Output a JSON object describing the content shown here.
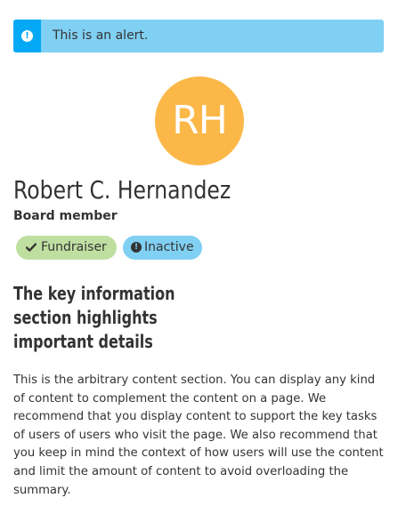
{
  "alert": {
    "icon": "exclamation-circle-icon",
    "text": "This is an alert.",
    "color": "#80d0f3",
    "accent_color": "#03a9f4"
  },
  "profile": {
    "initials": "RH",
    "avatar_color": "#fbb848",
    "name": "Robert C. Hernandez",
    "role": "Board member"
  },
  "badges": [
    {
      "icon": "check-icon",
      "label": "Fundraiser",
      "color": "#bfdfa1"
    },
    {
      "icon": "exclamation-circle-icon",
      "label": "Inactive",
      "color": "#80d0f3"
    }
  ],
  "key_information": {
    "lines": [
      "The key information",
      "section highlights",
      "important details"
    ]
  },
  "content": {
    "text": "This is the arbitrary content section. You can display any kind of content to complement the content on a page. We recommend that you display content to support the key tasks of users of users who visit the page. We also recommend that you keep in mind the context of how users will use the content and limit the amount of content to avoid overloading the summary."
  }
}
